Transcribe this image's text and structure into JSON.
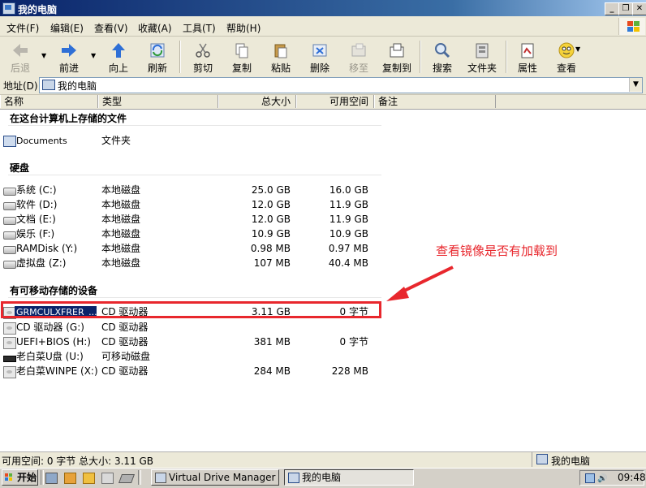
{
  "window": {
    "title": "我的电脑",
    "controls": {
      "minimize": "_",
      "restore": "❐",
      "close": "✕"
    }
  },
  "menu": [
    "文件(F)",
    "编辑(E)",
    "查看(V)",
    "收藏(A)",
    "工具(T)",
    "帮助(H)"
  ],
  "toolbar": {
    "back": "后退",
    "forward": "前进",
    "up": "向上",
    "refresh": "刷新",
    "cut": "剪切",
    "copy": "复制",
    "paste": "粘贴",
    "delete": "删除",
    "move_to": "移至",
    "copy_to": "复制到",
    "search": "搜索",
    "folders": "文件夹",
    "properties": "属性",
    "views": "查看"
  },
  "address": {
    "label": "地址(D)",
    "value": "我的电脑"
  },
  "columns": {
    "name": "名称",
    "type": "类型",
    "total": "总大小",
    "free": "可用空间",
    "comment": "备注"
  },
  "groups": {
    "stored": {
      "title": "在这台计算机上存储的文件",
      "items": [
        {
          "name": "Documents",
          "type": "文件夹",
          "total": "",
          "free": ""
        }
      ]
    },
    "hdd": {
      "title": "硬盘",
      "items": [
        {
          "name": "系统 (C:)",
          "type": "本地磁盘",
          "total": "25.0 GB",
          "free": "16.0 GB"
        },
        {
          "name": "软件 (D:)",
          "type": "本地磁盘",
          "total": "12.0 GB",
          "free": "11.9 GB"
        },
        {
          "name": "文档 (E:)",
          "type": "本地磁盘",
          "total": "12.0 GB",
          "free": "11.9 GB"
        },
        {
          "name": "娱乐 (F:)",
          "type": "本地磁盘",
          "total": "10.9 GB",
          "free": "10.9 GB"
        },
        {
          "name": "RAMDisk (Y:)",
          "type": "本地磁盘",
          "total": "0.98 MB",
          "free": "0.97 MB"
        },
        {
          "name": "虚拟盘 (Z:)",
          "type": "本地磁盘",
          "total": "107 MB",
          "free": "40.4 MB"
        }
      ]
    },
    "removable": {
      "title": "有可移动存储的设备",
      "items": [
        {
          "name": "GRMCULXFRER_...",
          "type": "CD 驱动器",
          "total": "3.11 GB",
          "free": "0 字节",
          "selected": true
        },
        {
          "name": "CD 驱动器 (G:)",
          "type": "CD 驱动器",
          "total": "",
          "free": ""
        },
        {
          "name": "UEFI+BIOS (H:)",
          "type": "CD 驱动器",
          "total": "381 MB",
          "free": "0 字节"
        },
        {
          "name": "老白菜U盘 (U:)",
          "type": "可移动磁盘",
          "total": "",
          "free": ""
        },
        {
          "name": "老白菜WINPE (X:)",
          "type": "CD 驱动器",
          "total": "284 MB",
          "free": "228 MB"
        }
      ]
    }
  },
  "annotation": {
    "text": "查看镜像是否有加载到",
    "color": "#e8272d"
  },
  "statusbar": {
    "left": "可用空间: 0 字节 总大小: 3.11 GB",
    "right": "我的电脑"
  },
  "taskbar": {
    "start": "开始",
    "tasks": [
      "Virtual Drive Manager",
      "我的电脑"
    ],
    "clock": "09:48"
  },
  "colors": {
    "title_bar": "#0a246a",
    "selection": "#0a246a",
    "chrome": "#ece9d8",
    "annotation": "#e8272d"
  }
}
